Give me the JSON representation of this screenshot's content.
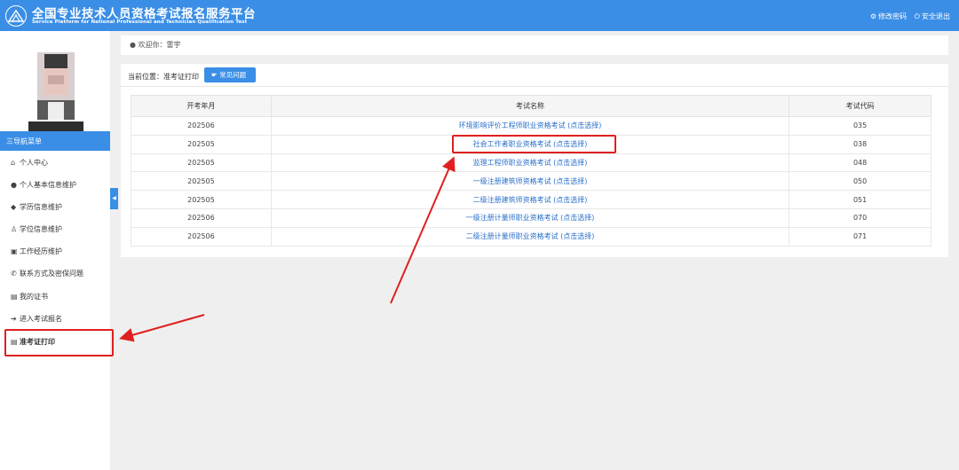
{
  "header": {
    "title": "全国专业技术人员资格考试报名服务平台",
    "subtitle": "Service Platform for National Professional and Technician Qualification Test",
    "change_password": "修改密码",
    "logout": "安全退出"
  },
  "welcome": {
    "label": "欢迎你：雷宇"
  },
  "sidebar": {
    "nav_title": "三导航菜单",
    "items": [
      {
        "label": "个人中心",
        "icon": "home-icon"
      },
      {
        "label": "个人基本信息维护",
        "icon": "user-icon"
      },
      {
        "label": "学历信息维护",
        "icon": "graduation-cap-icon"
      },
      {
        "label": "学位信息维护",
        "icon": "degree-icon"
      },
      {
        "label": "工作经历维护",
        "icon": "briefcase-icon"
      },
      {
        "label": "联系方式及密保问题",
        "icon": "phone-icon"
      },
      {
        "label": "我的证书",
        "icon": "certificate-icon"
      },
      {
        "label": "进入考试报名",
        "icon": "arrow-circle-icon"
      },
      {
        "label": "准考证打印",
        "icon": "print-icon",
        "active": true
      }
    ]
  },
  "breadcrumb": {
    "label": "当前位置：准考证打印"
  },
  "faq_button": {
    "label": "常见问题"
  },
  "table": {
    "headers": [
      "开考年月",
      "考试名称",
      "考试代码"
    ],
    "rows": [
      {
        "date": "202506",
        "name": "环境影响评价工程师职业资格考试 (点击选择)",
        "code": "035"
      },
      {
        "date": "202505",
        "name": "社会工作者职业资格考试 (点击选择)",
        "code": "038"
      },
      {
        "date": "202505",
        "name": "监理工程师职业资格考试 (点击选择)",
        "code": "048"
      },
      {
        "date": "202505",
        "name": "一级注册建筑师资格考试 (点击选择)",
        "code": "050"
      },
      {
        "date": "202505",
        "name": "二级注册建筑师资格考试 (点击选择)",
        "code": "051"
      },
      {
        "date": "202506",
        "name": "一级注册计量师职业资格考试 (点击选择)",
        "code": "070"
      },
      {
        "date": "202506",
        "name": "二级注册计量师职业资格考试 (点击选择)",
        "code": "071"
      }
    ]
  },
  "colors": {
    "primary": "#3a8ee6",
    "highlight": "#e02020",
    "link": "#2a6fc9"
  }
}
